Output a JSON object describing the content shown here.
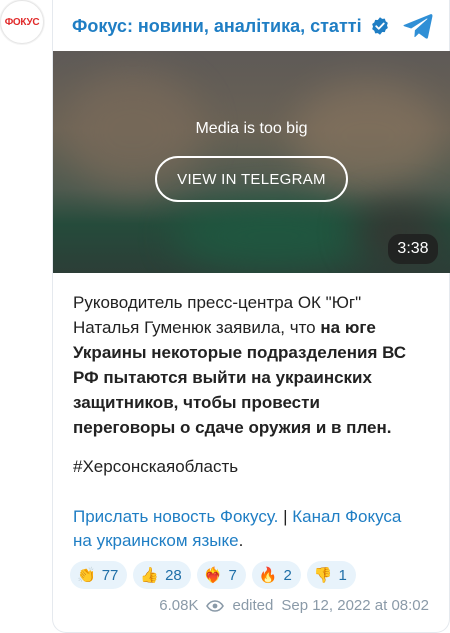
{
  "avatar_text": "ФОКУС",
  "channel": {
    "name": "Фокус: новини, аналітика, статті"
  },
  "media": {
    "notice": "Media is too big",
    "button_label": "VIEW IN TELEGRAM",
    "duration": "3:38"
  },
  "post": {
    "part1": "Руководитель пресс-центра ОК \"Юг\" Наталья Гуменюк заявила, что ",
    "bold": "на юге Украины некоторые подразделения ВС РФ пытаются выйти на украинских защитников, чтобы провести переговоры о сдаче оружия и в плен.",
    "hashtag": "#Херсонскаяобласть",
    "link1": "Прислать новость Фокусу.",
    "separator": " | ",
    "link2": "Канал Фокуса на украинском языке",
    "end": "."
  },
  "reactions": [
    {
      "emoji": "👏",
      "count": "77"
    },
    {
      "emoji": "👍",
      "count": "28"
    },
    {
      "emoji": "❤️‍🔥",
      "count": "7"
    },
    {
      "emoji": "🔥",
      "count": "2"
    },
    {
      "emoji": "👎",
      "count": "1"
    }
  ],
  "footer": {
    "views": "6.08K",
    "edited": "edited",
    "date": "Sep 12, 2022 at 08:02"
  },
  "colors": {
    "accent": "#1f7ec4",
    "brand_red": "#e12a2a",
    "reaction_bg": "#e8f3fb",
    "meta_gray": "#8a9aa8"
  }
}
